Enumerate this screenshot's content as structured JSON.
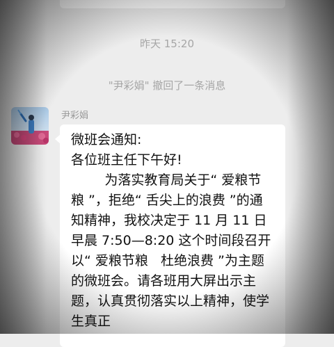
{
  "chat": {
    "timestamp": "昨天 15:20",
    "recall_notice": "\"尹彩娟\" 撤回了一条消息",
    "message": {
      "sender": "尹彩娟",
      "avatar": "avatar-photo",
      "text": "微班会通知:\n各位班主任下午好!\n        为落实教育局关于“ 爱粮节粮 ”，拒绝“ 舌尖上的浪费 ”的通知精神，我校决定于 11 月 11 日早晨 7:50—8:20 这个时间段召开以“ 爱粮节粮   杜绝浪费 ”为主题的微班会。请各班用大屏出示主题，认真贯彻落实以上精神，使学生真正"
    }
  },
  "colors": {
    "background": "#ededed",
    "bubble": "#ffffff",
    "meta_text": "#a6a6a6"
  }
}
